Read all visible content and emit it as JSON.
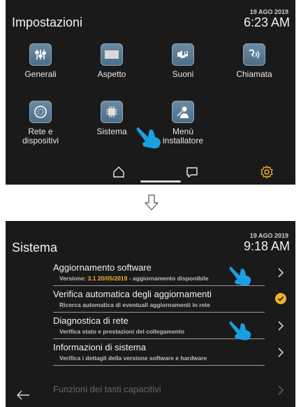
{
  "screen1": {
    "title": "Impostazioni",
    "date": "19 AGO 2019",
    "time": "6:23 AM",
    "apps": [
      {
        "label": "Generali",
        "icon": "sliders-icon"
      },
      {
        "label": "Aspetto",
        "icon": "display-icon"
      },
      {
        "label": "Suoni",
        "icon": "sound-icon"
      },
      {
        "label": "Chiamata",
        "icon": "call-icon"
      },
      {
        "label": "Rete e\ndispositivi",
        "icon": "network-icon"
      },
      {
        "label": "Sistema",
        "icon": "chip-icon"
      },
      {
        "label": "Menù\ninstallatore",
        "icon": "installer-icon"
      }
    ],
    "nav": [
      "home-icon",
      "chat-icon",
      "gear-icon"
    ]
  },
  "screen2": {
    "title": "Sistema",
    "date": "19 AGO 2019",
    "time": "9:18 AM",
    "items": [
      {
        "title": "Aggiornamento software",
        "sub_prefix": "Versione: ",
        "sub_highlight": "3.1 20/05/2019",
        "sub_suffix": " - aggiornamento disponibile",
        "control": "chevron"
      },
      {
        "title": "Verifica automatica degli aggiornamenti",
        "sub": "Ricerca automatica di eventuali aggiornamenti in rete",
        "control": "check"
      },
      {
        "title": "Diagnostica di rete",
        "sub": "Verifica stato e prestazioni del collegamento",
        "control": "chevron"
      },
      {
        "title": "Informazioni di sistema",
        "sub": "Verifica i dettagli della versione software e hardware",
        "control": "chevron"
      },
      {
        "title": "Funzioni dei tasti capacitivi",
        "control": "chevron"
      }
    ]
  },
  "colors": {
    "accent": "#f0b429",
    "hand": "#1aa0e0",
    "screen_bg": "#1a1a1a",
    "icon_bg": "#5a7a94"
  }
}
